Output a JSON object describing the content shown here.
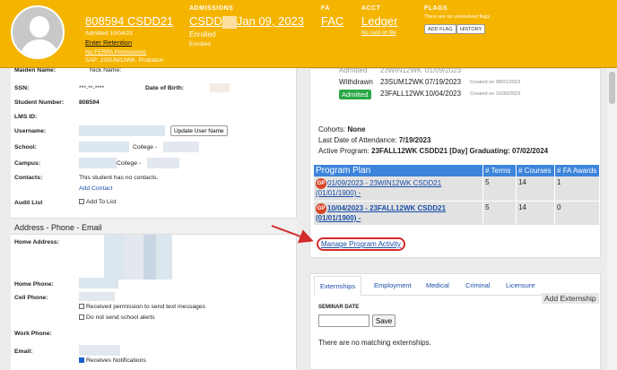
{
  "banner": {
    "student_id_name": "808594 CSDD21",
    "admitted": "Admitted 10/04/23",
    "enter_retention": "Enter Retention",
    "ferpa": "No FERPA Permissions",
    "sap": "SAP: 23SUM12WK: Probation",
    "admissions_head": "ADMISSIONS",
    "admissions_link_a": "CSDD",
    "admissions_link_b": "Jan 09, 2023",
    "enrolled_1": "Enrolled",
    "enrolled_2": "Enrolled",
    "fa_head": "FA",
    "fa_link": "FAC",
    "acct_head": "ACCT",
    "acct_link": "Ledger",
    "no_card": "No card on file",
    "flags_head": "FLAGS",
    "flags_note": "There are no unresolved flags",
    "add_flag": "ADD FLAG",
    "history": "HISTORY"
  },
  "left": {
    "maiden_label": "Maiden Name:",
    "nick_label": "Nick Name:",
    "ssn_label": "SSN:",
    "ssn_value": "***-**-****",
    "dob_label": "Date of Birth:",
    "student_number_label": "Student Number:",
    "student_number_value": "808594",
    "lms_label": "LMS ID:",
    "username_label": "Username:",
    "update_user": "Update User Name",
    "school_label": "School:",
    "school_value": "College -",
    "campus_label": "Campus:",
    "campus_value": "College -",
    "contacts_label": "Contacts:",
    "contacts_value": "This student has no contacts.",
    "add_contact": "Add Contact",
    "audit_label": "Audit List",
    "add_to_list": "Add To List",
    "address_section": "Address - Phone - Email",
    "home_address_label": "Home Address:",
    "home_phone_label": "Home Phone:",
    "cell_phone_label": "Cell Phone:",
    "permission_text": "Received permission to send text messages",
    "no_school_alerts": "Do not send school alerts",
    "work_phone_label": "Work Phone:",
    "email_label": "Email:",
    "receives_notifications": "Receives Notifications"
  },
  "programs": {
    "admitted_top_a": "Admitted",
    "admitted_top_b": "23WIN12WK",
    "admitted_top_c": "01/09/2023",
    "withdrawn_label": "Withdrawn",
    "withdrawn_term": "23SUM12WK",
    "withdrawn_date": "07/19/2023",
    "withdrawn_created": "Created on 08/01/2023",
    "admitted_label": "Admitted",
    "admitted_term": "23FALL12WK",
    "admitted_date": "10/04/2023",
    "admitted_created": "Created on 10/30/2023"
  },
  "info": {
    "cohorts_label": "Cohorts: ",
    "cohorts_value": "None",
    "last_attendance_label": "Last Date of Attendance: ",
    "last_attendance_value": "7/19/2023",
    "active_program_label": "Active Program: ",
    "active_program_value": "23FALL12WK CSDD21 [Day] Graduating: 07/02/2024"
  },
  "program_plan": {
    "headers": [
      "Program Plan",
      "# Terms",
      "# Courses",
      "# FA Awards"
    ],
    "rows": [
      {
        "badge": "GP",
        "plan": "01/09/2023 - 23WIN12WK CSDD21 (01/01/1900) -",
        "terms": "5",
        "courses": "14",
        "fa_awards": "1"
      },
      {
        "badge": "GP",
        "plan": "10/04/2023 - 23FALL12WK CSDD21 (01/01/1900) -",
        "terms": "5",
        "courses": "14",
        "fa_awards": "0"
      }
    ],
    "manage_link": "Manage Program Activity"
  },
  "tabs": {
    "items": [
      "Externships",
      "Employment",
      "Medical",
      "Criminal",
      "Licensure"
    ],
    "add_externship": "Add Externship",
    "seminar_label": "SEMINAR DATE",
    "save": "Save",
    "no_matching": "There are no matching externships."
  },
  "colors": {
    "banner": "#f5b400",
    "header_blue": "#3d84db",
    "admitted_green": "#2aa745",
    "annotation_red": "#d42b2b"
  }
}
